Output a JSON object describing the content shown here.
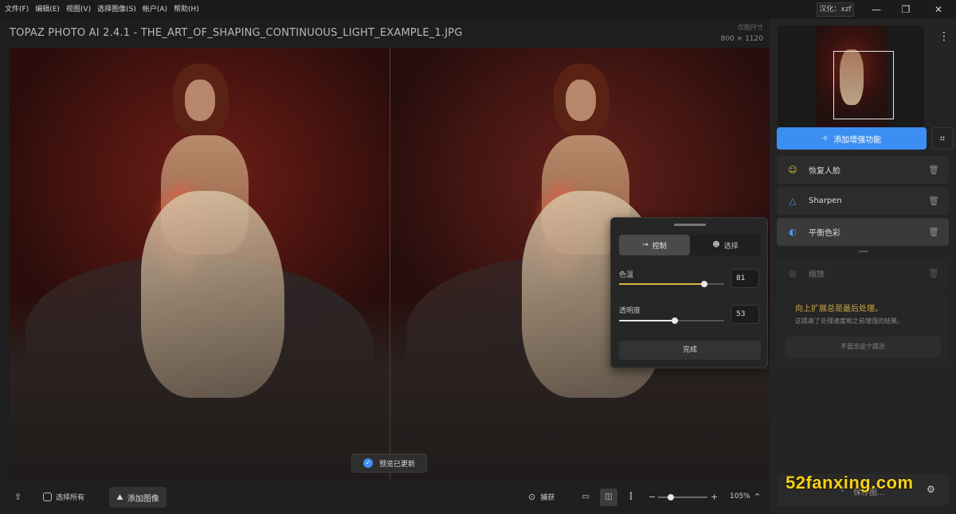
{
  "menu": [
    "文件(F)",
    "编辑(E)",
    "视图(V)",
    "选择图像(S)",
    "帐户(A)",
    "帮助(H)"
  ],
  "lang_badge": "汉化：xzf",
  "window_controls": {
    "minimize": "—",
    "restore": "❐",
    "close": "✕"
  },
  "doc": {
    "title": "TOPAZ PHOTO AI 2.4.1 - THE_ART_OF_SHAPING_CONTINUOUS_LIGHT_EXAMPLE_1.JPG",
    "size_label": "仅图尺寸",
    "size_value": "800 × 1120"
  },
  "toast": "预览已更新",
  "popup": {
    "tab_control": "控制",
    "tab_select": "选择",
    "slider1": {
      "label": "色温",
      "value": "81",
      "percent": 81,
      "color": "#d9b93c"
    },
    "slider2": {
      "label": "透明度",
      "value": "53",
      "percent": 53,
      "color": "#e8e8e8"
    },
    "done": "完成"
  },
  "panel": {
    "add_button": "添加增强功能",
    "items": [
      {
        "label": "恢复人脸",
        "icon": "face-icon",
        "glyph": "☺",
        "color": "#e6c23a"
      },
      {
        "label": "Sharpen",
        "icon": "triangle-icon",
        "glyph": "△",
        "color": "#4b94f0"
      },
      {
        "label": "平衡色彩",
        "icon": "toggle-icon",
        "glyph": "◐",
        "color": "#4b94f0"
      },
      {
        "label": "缩放",
        "icon": "hidden-eye-icon",
        "glyph": "◎",
        "color": "#6a6a6a"
      }
    ],
    "notice_title": "向上扩展总是最后处理。",
    "notice_sub": "这提高了处理速度和之前增强的结果。",
    "notice_button": "不显示这个提示",
    "save_label": "保存图..."
  },
  "watermark": "52fanxing.com",
  "bottombar": {
    "select_all": "选择所有",
    "add_image": "添加图像",
    "capture": "捕获",
    "zoom": "105%",
    "zoom_level": 0.25
  }
}
